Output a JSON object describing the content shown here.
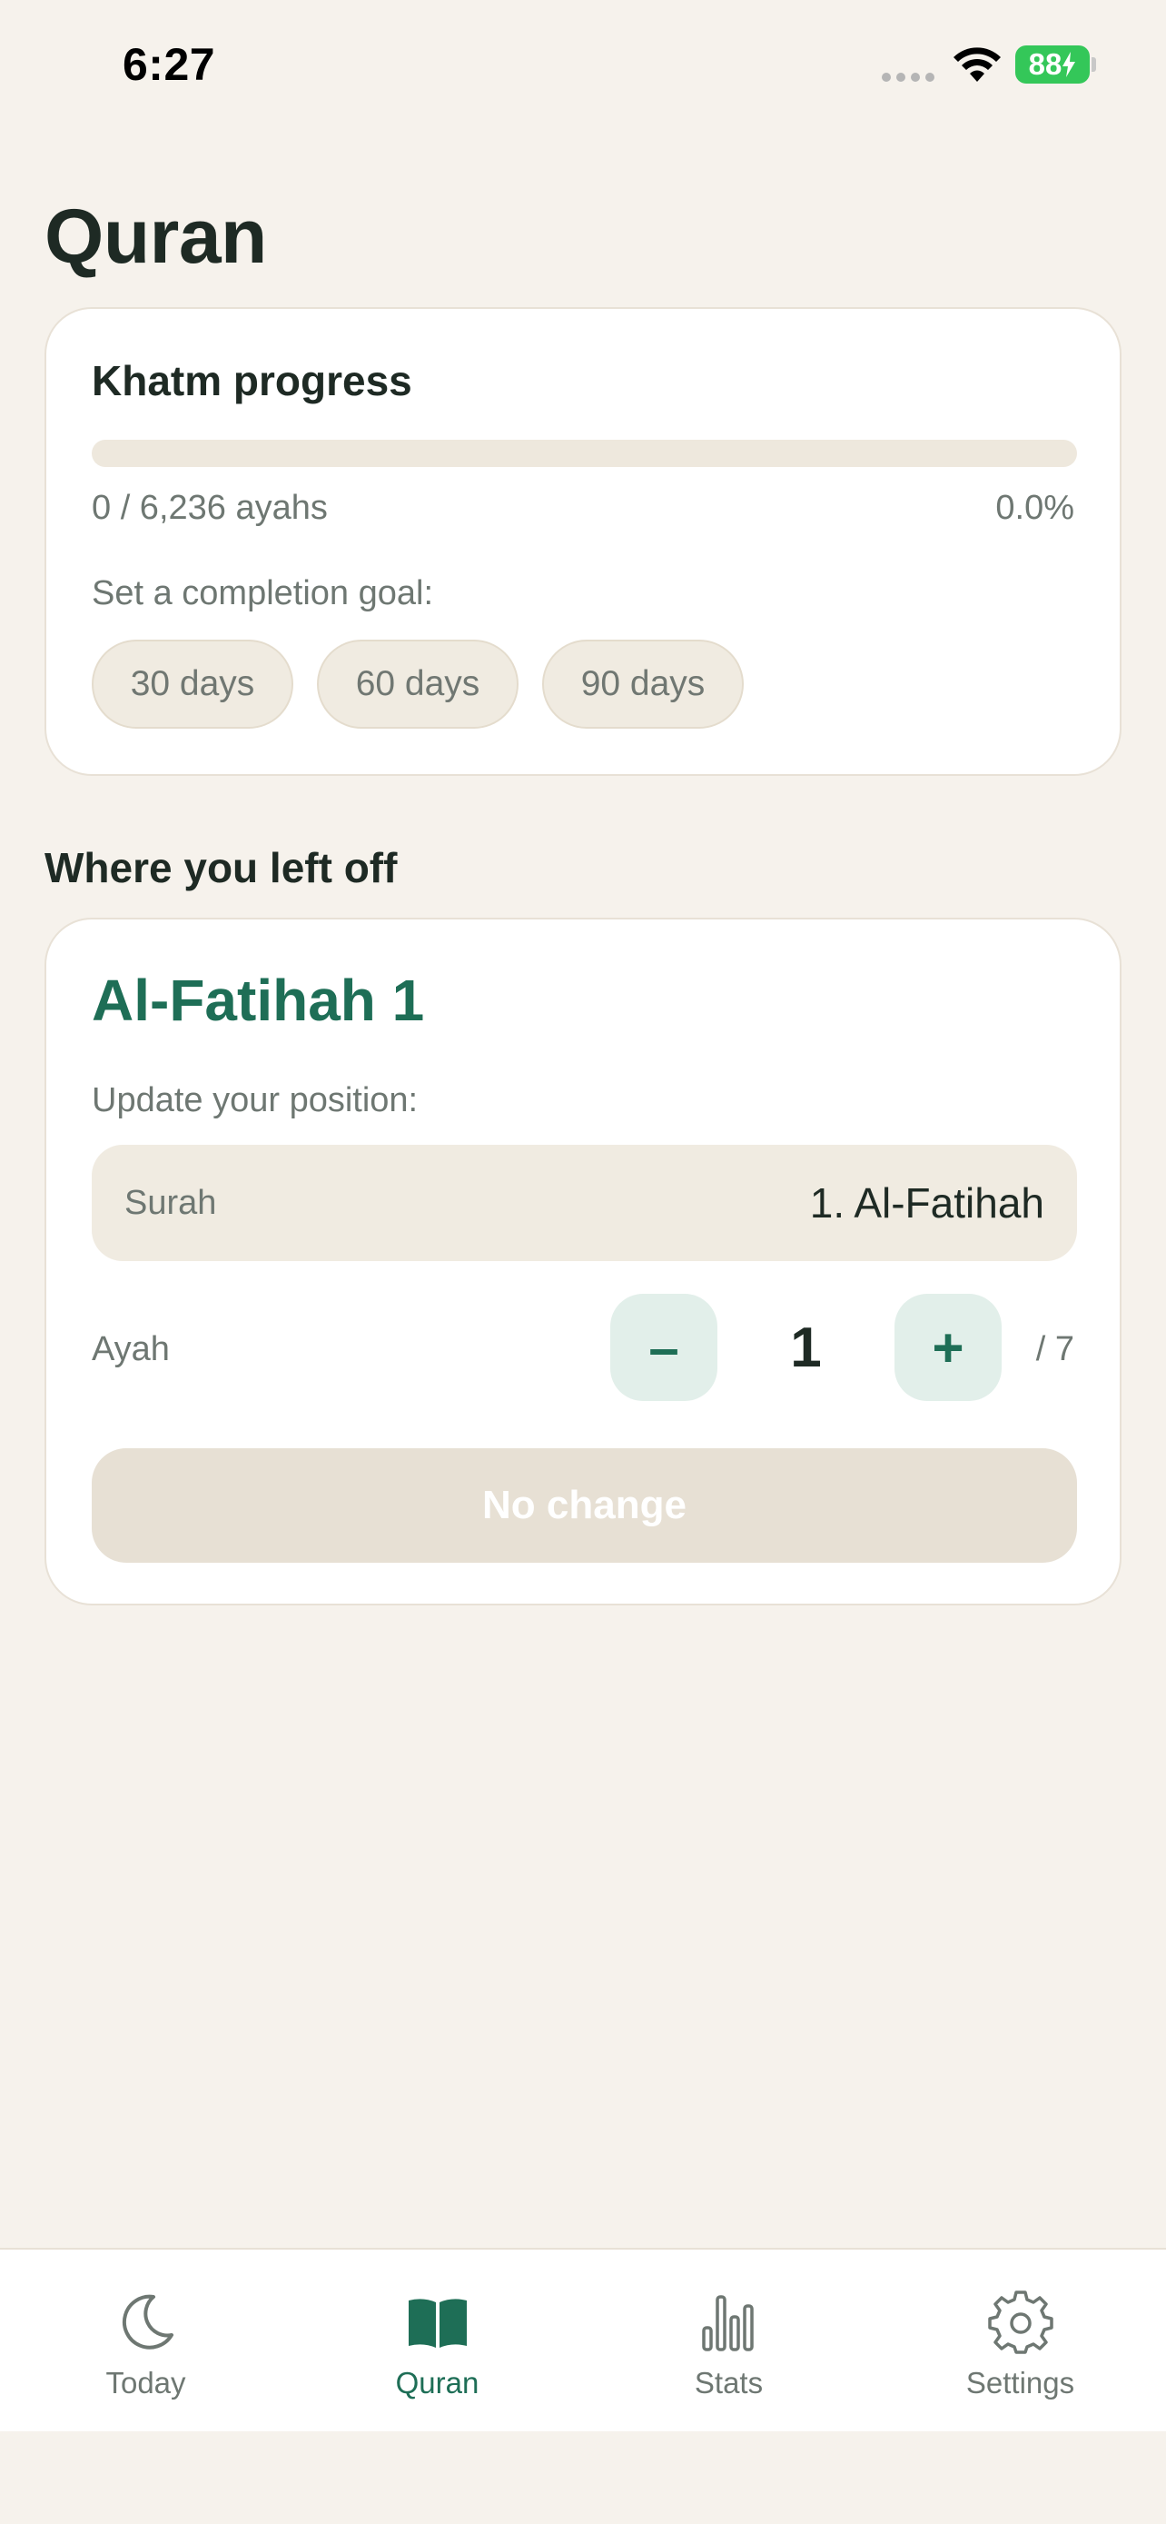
{
  "status_bar": {
    "time": "6:27",
    "battery": "88"
  },
  "page": {
    "title": "Quran"
  },
  "khatm": {
    "title": "Khatm progress",
    "progress_fraction": 0.0,
    "count_text": "0 / 6,236 ayahs",
    "percent_text": "0.0%",
    "goal_label": "Set a completion goal:",
    "goal_options": [
      "30 days",
      "60 days",
      "90 days"
    ]
  },
  "position": {
    "section_heading": "Where you left off",
    "current": "Al-Fatihah 1",
    "update_label": "Update your position:",
    "surah_label": "Surah",
    "surah_value": "1. Al-Fatihah",
    "ayah_label": "Ayah",
    "minus_label": "–",
    "plus_label": "+",
    "ayah_value": "1",
    "ayah_total": "/ 7",
    "button_label": "No change"
  },
  "tabs": [
    {
      "label": "Today",
      "icon": "moon-icon",
      "active": false
    },
    {
      "label": "Quran",
      "icon": "book-icon",
      "active": true
    },
    {
      "label": "Stats",
      "icon": "bar-chart-icon",
      "active": false
    },
    {
      "label": "Settings",
      "icon": "gear-icon",
      "active": false
    }
  ],
  "colors": {
    "background": "#F6F2EC",
    "accent": "#1E6E56",
    "card": "#FFFFFF",
    "chip": "#F0EBE1",
    "battery": "#34C759"
  }
}
